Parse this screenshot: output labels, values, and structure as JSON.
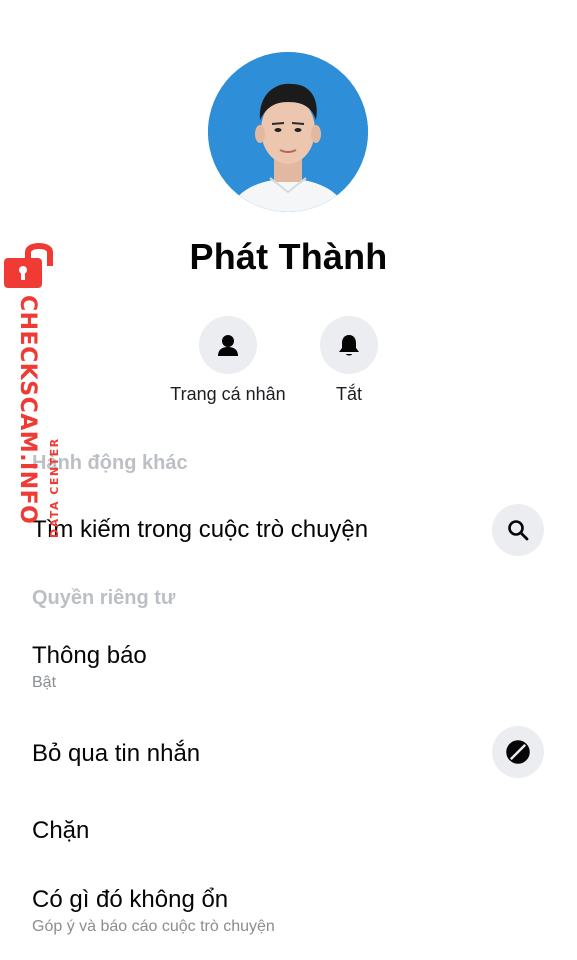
{
  "profile": {
    "name": "Phát Thành"
  },
  "actions": [
    {
      "label": "Trang cá nhân",
      "icon": "profile-icon"
    },
    {
      "label": "Tắt",
      "icon": "bell-icon"
    }
  ],
  "sections": {
    "other_actions": {
      "header": "Hành động khác",
      "search": {
        "title": "Tìm kiếm trong cuộc trò chuyện",
        "icon": "search-icon"
      }
    },
    "privacy": {
      "header": "Quyền riêng tư",
      "notifications": {
        "title": "Thông báo",
        "subtitle": "Bật"
      },
      "ignore": {
        "title": "Bỏ qua tin nhắn",
        "icon": "ignore-icon"
      },
      "block": {
        "title": "Chặn"
      },
      "report": {
        "title": "Có gì đó không ổn",
        "subtitle": "Góp ý và báo cáo cuộc trò chuyện"
      }
    }
  },
  "watermark": {
    "main": "CHECKSCAM.INFO",
    "sub": "DATA CENTER",
    "color": "#ef3b33"
  },
  "colors": {
    "icon_bg": "#ebedf0",
    "section_header": "#bcc0c4",
    "text": "#050505",
    "subtext": "#8a8d91"
  }
}
